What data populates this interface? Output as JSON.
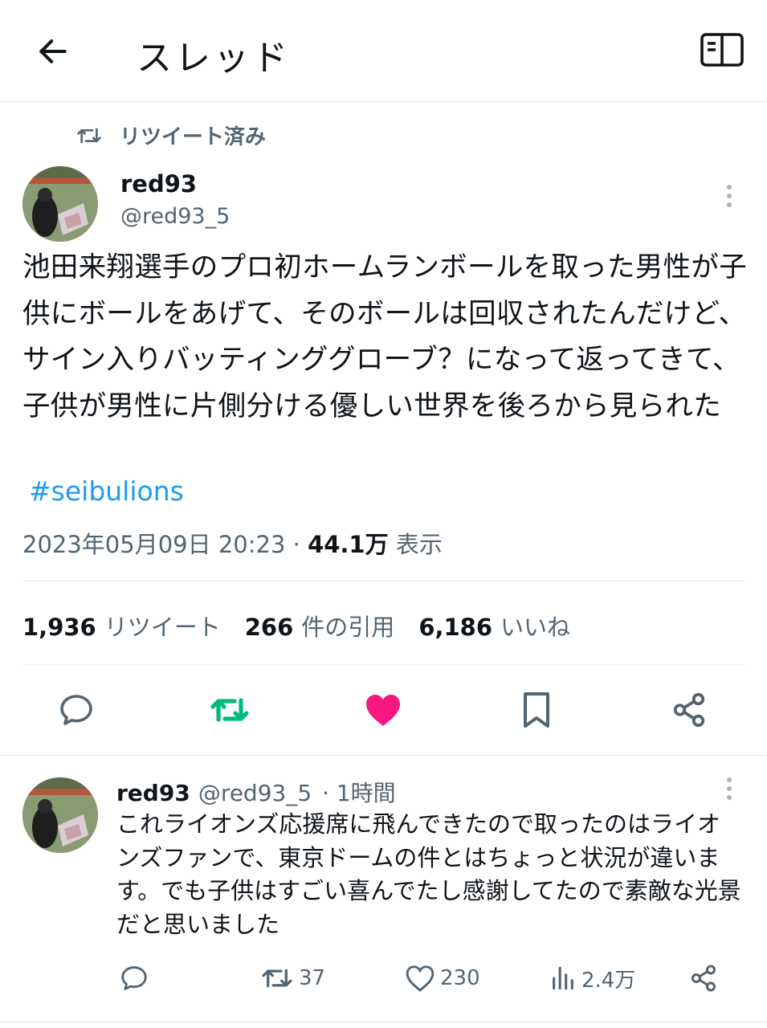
{
  "header": {
    "title": "スレッド",
    "back_icon": "arrow-left-icon",
    "reader_icon": "book-open-icon"
  },
  "retweeted_label": "リツイート済み",
  "tweet": {
    "display_name": "red93",
    "handle": "@red93_5",
    "text": "池田来翔選手のプロ初ホームランボールを取った男性が子供にボールをあげて、そのボールは回収されたんだけど、サイン入りバッティンググローブ？になって返ってきて、子供が男性に片側分ける優しい世界を後ろから見られた",
    "hashtag": "#seibulions",
    "timestamp": "2023年05月09日 20:23",
    "separator": "·",
    "views_count": "44.1万",
    "views_label": "表示",
    "stats": {
      "retweets_count": "1,936",
      "retweets_label": "リツイート",
      "quotes_count": "266",
      "quotes_label": "件の引用",
      "likes_count": "6,186",
      "likes_label": "いいね"
    }
  },
  "reply": {
    "display_name": "red93",
    "handle": "@red93_5",
    "time": "· 1時間",
    "text": "これライオンズ応援席に飛んできたので取ったのはライオンズファンで、東京ドームの件とはちょっと状況が違います。でも子供はすごい喜んでたし感謝してたので素敵な光景だと思いました",
    "retweets": "37",
    "likes": "230",
    "views": "2.4万"
  },
  "colors": {
    "retweet_active": "#00ba7c",
    "like_active": "#f91880",
    "link": "#1d9bf0",
    "secondary_text": "#536471"
  }
}
